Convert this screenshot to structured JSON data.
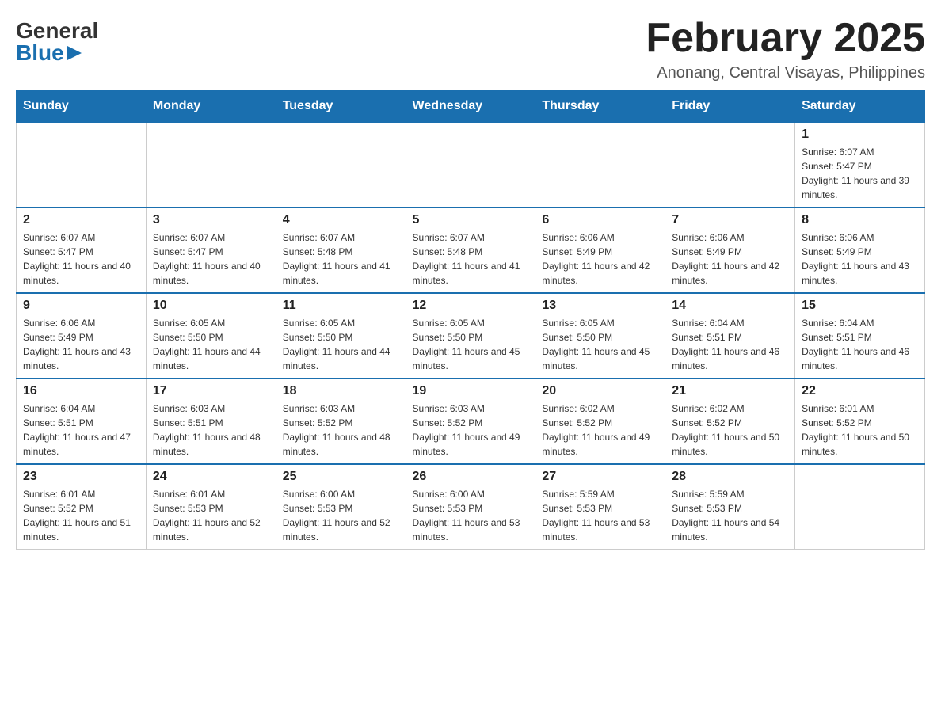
{
  "logo": {
    "general": "General",
    "blue": "Blue"
  },
  "title": {
    "month_year": "February 2025",
    "location": "Anonang, Central Visayas, Philippines"
  },
  "days_of_week": [
    "Sunday",
    "Monday",
    "Tuesday",
    "Wednesday",
    "Thursday",
    "Friday",
    "Saturday"
  ],
  "weeks": [
    {
      "days": [
        {
          "number": "",
          "info": ""
        },
        {
          "number": "",
          "info": ""
        },
        {
          "number": "",
          "info": ""
        },
        {
          "number": "",
          "info": ""
        },
        {
          "number": "",
          "info": ""
        },
        {
          "number": "",
          "info": ""
        },
        {
          "number": "1",
          "info": "Sunrise: 6:07 AM\nSunset: 5:47 PM\nDaylight: 11 hours and 39 minutes."
        }
      ]
    },
    {
      "days": [
        {
          "number": "2",
          "info": "Sunrise: 6:07 AM\nSunset: 5:47 PM\nDaylight: 11 hours and 40 minutes."
        },
        {
          "number": "3",
          "info": "Sunrise: 6:07 AM\nSunset: 5:47 PM\nDaylight: 11 hours and 40 minutes."
        },
        {
          "number": "4",
          "info": "Sunrise: 6:07 AM\nSunset: 5:48 PM\nDaylight: 11 hours and 41 minutes."
        },
        {
          "number": "5",
          "info": "Sunrise: 6:07 AM\nSunset: 5:48 PM\nDaylight: 11 hours and 41 minutes."
        },
        {
          "number": "6",
          "info": "Sunrise: 6:06 AM\nSunset: 5:49 PM\nDaylight: 11 hours and 42 minutes."
        },
        {
          "number": "7",
          "info": "Sunrise: 6:06 AM\nSunset: 5:49 PM\nDaylight: 11 hours and 42 minutes."
        },
        {
          "number": "8",
          "info": "Sunrise: 6:06 AM\nSunset: 5:49 PM\nDaylight: 11 hours and 43 minutes."
        }
      ]
    },
    {
      "days": [
        {
          "number": "9",
          "info": "Sunrise: 6:06 AM\nSunset: 5:49 PM\nDaylight: 11 hours and 43 minutes."
        },
        {
          "number": "10",
          "info": "Sunrise: 6:05 AM\nSunset: 5:50 PM\nDaylight: 11 hours and 44 minutes."
        },
        {
          "number": "11",
          "info": "Sunrise: 6:05 AM\nSunset: 5:50 PM\nDaylight: 11 hours and 44 minutes."
        },
        {
          "number": "12",
          "info": "Sunrise: 6:05 AM\nSunset: 5:50 PM\nDaylight: 11 hours and 45 minutes."
        },
        {
          "number": "13",
          "info": "Sunrise: 6:05 AM\nSunset: 5:50 PM\nDaylight: 11 hours and 45 minutes."
        },
        {
          "number": "14",
          "info": "Sunrise: 6:04 AM\nSunset: 5:51 PM\nDaylight: 11 hours and 46 minutes."
        },
        {
          "number": "15",
          "info": "Sunrise: 6:04 AM\nSunset: 5:51 PM\nDaylight: 11 hours and 46 minutes."
        }
      ]
    },
    {
      "days": [
        {
          "number": "16",
          "info": "Sunrise: 6:04 AM\nSunset: 5:51 PM\nDaylight: 11 hours and 47 minutes."
        },
        {
          "number": "17",
          "info": "Sunrise: 6:03 AM\nSunset: 5:51 PM\nDaylight: 11 hours and 48 minutes."
        },
        {
          "number": "18",
          "info": "Sunrise: 6:03 AM\nSunset: 5:52 PM\nDaylight: 11 hours and 48 minutes."
        },
        {
          "number": "19",
          "info": "Sunrise: 6:03 AM\nSunset: 5:52 PM\nDaylight: 11 hours and 49 minutes."
        },
        {
          "number": "20",
          "info": "Sunrise: 6:02 AM\nSunset: 5:52 PM\nDaylight: 11 hours and 49 minutes."
        },
        {
          "number": "21",
          "info": "Sunrise: 6:02 AM\nSunset: 5:52 PM\nDaylight: 11 hours and 50 minutes."
        },
        {
          "number": "22",
          "info": "Sunrise: 6:01 AM\nSunset: 5:52 PM\nDaylight: 11 hours and 50 minutes."
        }
      ]
    },
    {
      "days": [
        {
          "number": "23",
          "info": "Sunrise: 6:01 AM\nSunset: 5:52 PM\nDaylight: 11 hours and 51 minutes."
        },
        {
          "number": "24",
          "info": "Sunrise: 6:01 AM\nSunset: 5:53 PM\nDaylight: 11 hours and 52 minutes."
        },
        {
          "number": "25",
          "info": "Sunrise: 6:00 AM\nSunset: 5:53 PM\nDaylight: 11 hours and 52 minutes."
        },
        {
          "number": "26",
          "info": "Sunrise: 6:00 AM\nSunset: 5:53 PM\nDaylight: 11 hours and 53 minutes."
        },
        {
          "number": "27",
          "info": "Sunrise: 5:59 AM\nSunset: 5:53 PM\nDaylight: 11 hours and 53 minutes."
        },
        {
          "number": "28",
          "info": "Sunrise: 5:59 AM\nSunset: 5:53 PM\nDaylight: 11 hours and 54 minutes."
        },
        {
          "number": "",
          "info": ""
        }
      ]
    }
  ]
}
